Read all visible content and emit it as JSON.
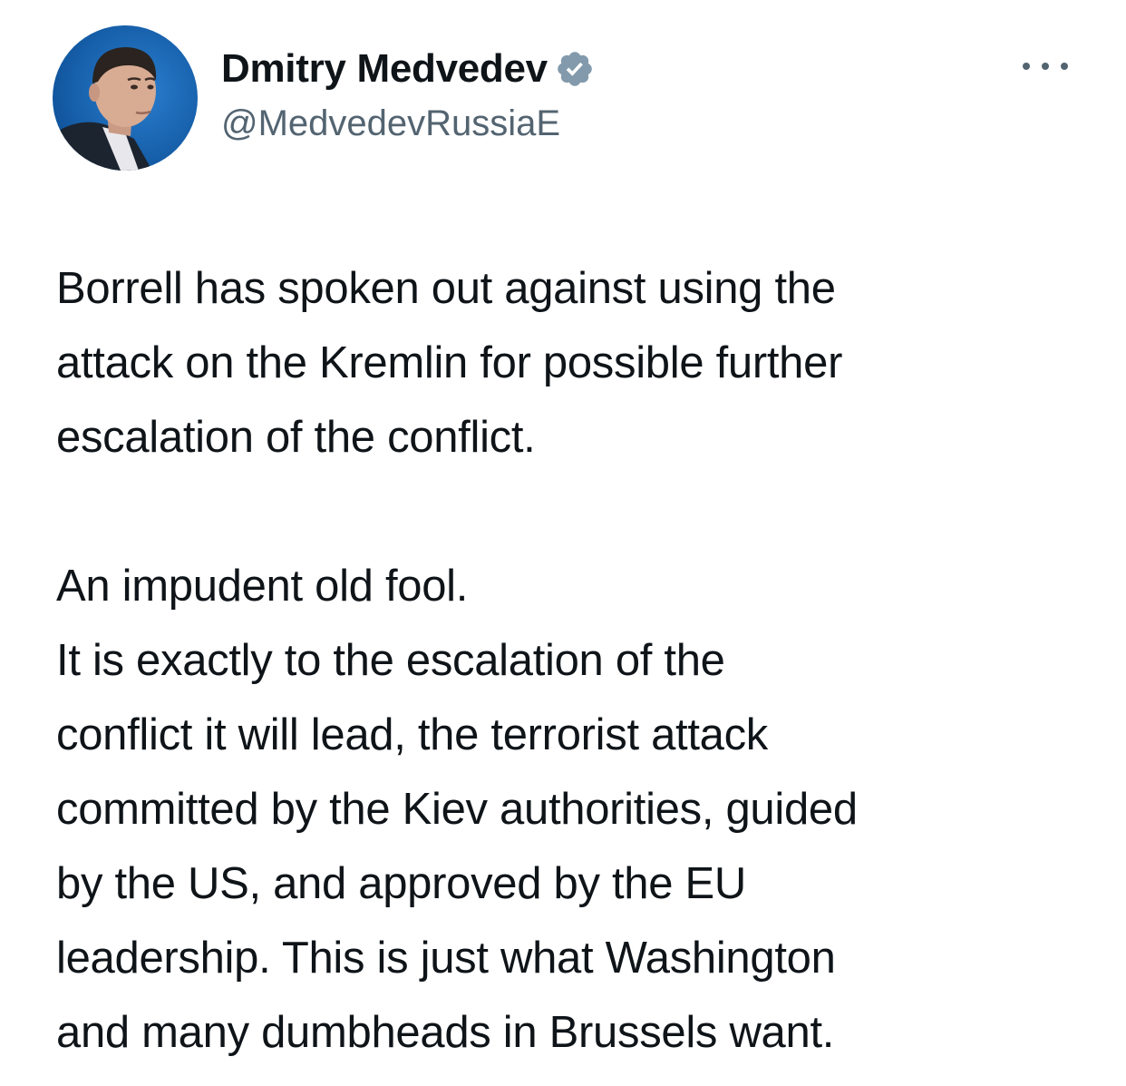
{
  "author": {
    "display_name": "Dmitry Medvedev",
    "handle": "@MedvedevRussiaE",
    "verified": true,
    "avatar_icon": "profile-photo",
    "verified_icon": "verified-badge-icon",
    "verified_color": "#829aab"
  },
  "menu": {
    "icon": "more-options-icon"
  },
  "tweet": {
    "paragraph1_lines": [
      "Borrell has spoken out against using the",
      "attack on the Kremlin for possible further",
      "escalation of the conflict."
    ],
    "paragraph2_lines": [
      "An impudent old fool.",
      "It is exactly to the escalation of the",
      "conflict it will lead, the terrorist attack",
      "committed by the Kiev authorities, guided",
      "by the US, and approved by the EU",
      "leadership. This is just what Washington",
      "and many dumbheads in Brussels want."
    ]
  }
}
